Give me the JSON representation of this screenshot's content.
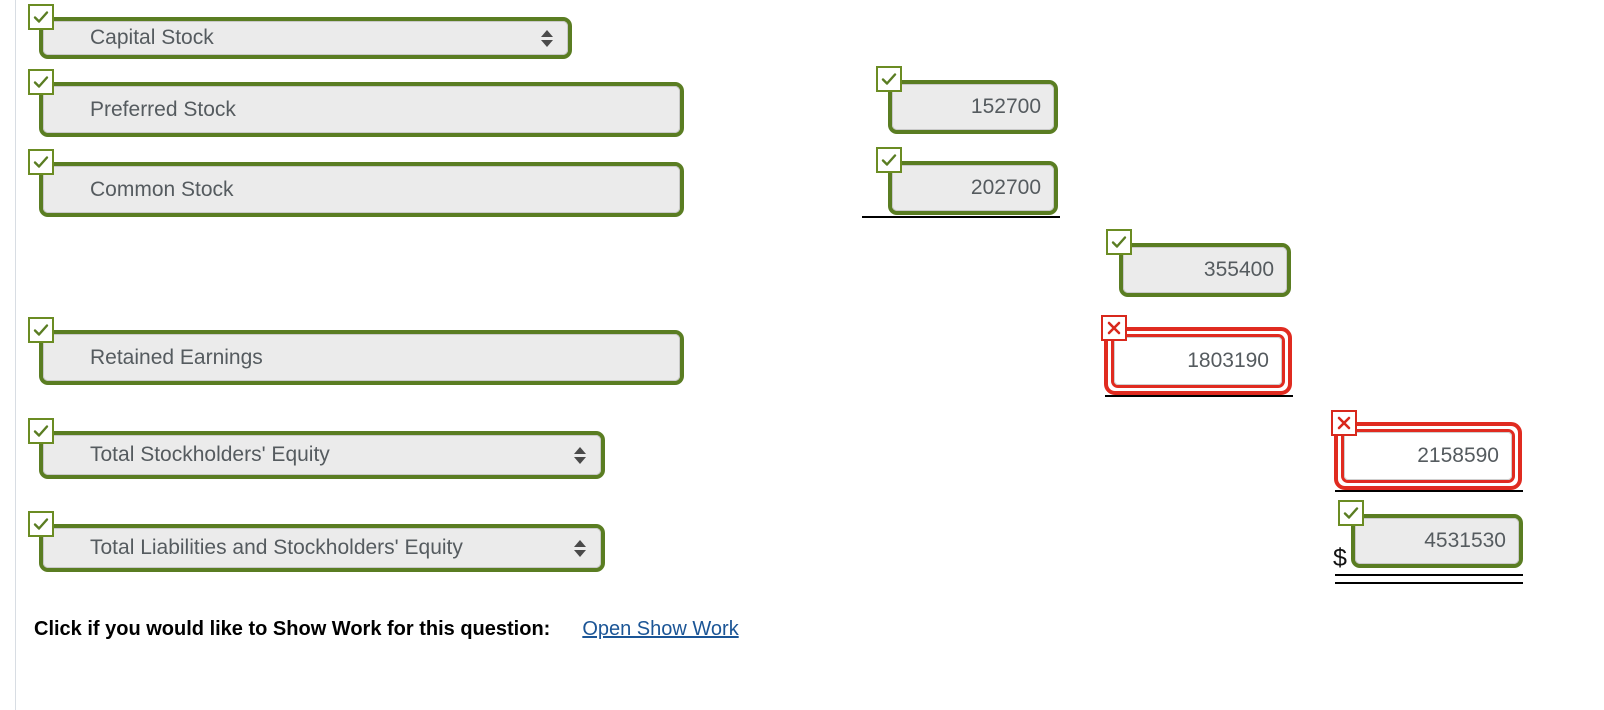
{
  "form": {
    "rows": [
      {
        "id": "capital-stock",
        "status": "ok",
        "label": "Capital Stock",
        "control": "select",
        "value": "",
        "value_status": ""
      },
      {
        "id": "preferred-stock",
        "status": "ok",
        "label": "Preferred Stock",
        "control": "text",
        "value": "152700",
        "value_status": "ok"
      },
      {
        "id": "common-stock",
        "status": "ok",
        "label": "Common Stock",
        "control": "text",
        "value": "202700",
        "value_status": "ok"
      },
      {
        "id": "capital-stock-subtotal",
        "status": "",
        "label": "",
        "control": "none",
        "value": "355400",
        "value_status": "ok"
      },
      {
        "id": "retained-earnings",
        "status": "ok",
        "label": "Retained Earnings",
        "control": "text",
        "value": "1803190",
        "value_status": "error"
      },
      {
        "id": "total-stockholders-equity",
        "status": "ok",
        "label": "Total Stockholders' Equity",
        "control": "select",
        "value": "2158590",
        "value_status": "error"
      },
      {
        "id": "total-liabilities-and-stockholders-equity",
        "status": "ok",
        "label": "Total Liabilities and Stockholders' Equity",
        "control": "select",
        "value": "4531530",
        "value_status": "ok"
      }
    ],
    "currency_symbol": "$"
  },
  "footer": {
    "prompt": "Click if you would like to Show Work for this question:",
    "link": "Open Show Work"
  },
  "icons": {
    "check": "check-icon",
    "cross": "cross-icon",
    "select_arrows": "select-updown-arrows-icon"
  },
  "colors": {
    "valid_border": "#5a7d22",
    "error_border": "#e02b20",
    "field_bg": "#ebebeb",
    "text": "#555b5f",
    "link": "#1b5596"
  }
}
